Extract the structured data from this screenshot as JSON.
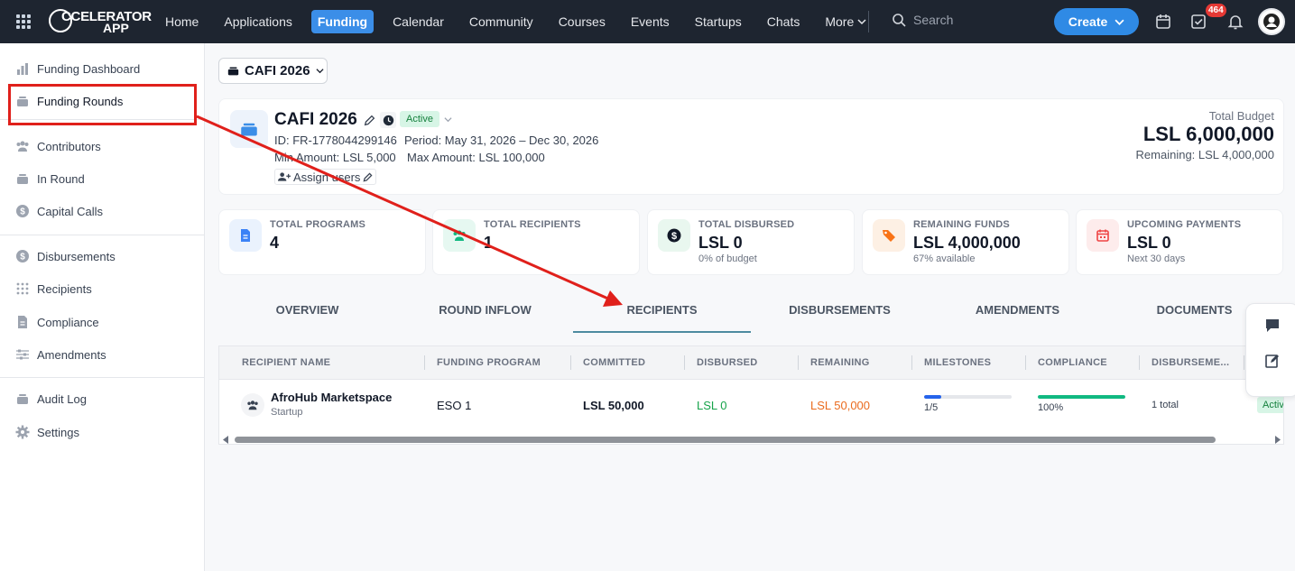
{
  "topbar": {
    "logo_line1": "CCELERATOR",
    "logo_line2": "APP",
    "nav": [
      "Home",
      "Applications",
      "Funding",
      "Calendar",
      "Community",
      "Courses",
      "Events",
      "Startups",
      "Chats"
    ],
    "more_label": "More",
    "search_placeholder": "Search",
    "create_label": "Create",
    "notification_count": "464"
  },
  "sidebar": {
    "items": [
      {
        "label": "Funding Dashboard",
        "icon": "bar-chart-icon"
      },
      {
        "label": "Funding Rounds",
        "icon": "stack-icon"
      },
      {
        "label": "Contributors",
        "icon": "users-icon"
      },
      {
        "label": "In Round",
        "icon": "layers-icon"
      },
      {
        "label": "Capital Calls",
        "icon": "dollar-circle-icon"
      },
      {
        "label": "Disbursements",
        "icon": "dollar-circle-icon"
      },
      {
        "label": "Recipients",
        "icon": "dots-grid-icon"
      },
      {
        "label": "Compliance",
        "icon": "document-icon"
      },
      {
        "label": "Amendments",
        "icon": "sliders-icon"
      },
      {
        "label": "Audit Log",
        "icon": "layers-icon"
      },
      {
        "label": "Settings",
        "icon": "gear-icon"
      }
    ]
  },
  "round_selector": "CAFI 2026",
  "round": {
    "title": "CAFI 2026",
    "status": "Active",
    "id_line": "ID: FR-1778044299146",
    "period_line": "Period: May 31, 2026 – Dec 30, 2026",
    "min_line": "Min Amount: LSL 5,000",
    "max_line": "Max Amount: LSL 100,000",
    "assign_label": "Assign users",
    "budget_label": "Total Budget",
    "budget_value": "LSL 6,000,000",
    "remaining": "Remaining: LSL 4,000,000"
  },
  "stats": [
    {
      "label": "TOTAL PROGRAMS",
      "value": "4",
      "sub": "",
      "color": "#3b82f6",
      "bg": "#eaf2fd"
    },
    {
      "label": "TOTAL RECIPIENTS",
      "value": "1",
      "sub": "",
      "color": "#10b981",
      "bg": "#e6f8f1"
    },
    {
      "label": "TOTAL DISBURSED",
      "value": "LSL 0",
      "sub": "0% of budget",
      "color": "#111827",
      "bg": "#e9f7ef"
    },
    {
      "label": "REMAINING FUNDS",
      "value": "LSL 4,000,000",
      "sub": "67% available",
      "color": "#f97316",
      "bg": "#fdf0e4"
    },
    {
      "label": "UPCOMING PAYMENTS",
      "value": "LSL 0",
      "sub": "Next 30 days",
      "color": "#ef4444",
      "bg": "#fdecec"
    }
  ],
  "tabs": [
    "OVERVIEW",
    "ROUND INFLOW",
    "RECIPIENTS",
    "DISBURSEMENTS",
    "AMENDMENTS",
    "DOCUMENTS"
  ],
  "table": {
    "headers": [
      "RECIPIENT NAME",
      "FUNDING PROGRAM",
      "COMMITTED",
      "DISBURSED",
      "REMAINING",
      "MILESTONES",
      "COMPLIANCE",
      "DISBURSEME..."
    ],
    "row": {
      "name": "AfroHub Marketspace",
      "type": "Startup",
      "program": "ESO 1",
      "committed": "LSL 50,000",
      "disbursed": "LSL 0",
      "remaining": "LSL 50,000",
      "milestones_text": "1/5",
      "milestones_fraction": 0.2,
      "compliance_text": "100%",
      "compliance_fraction": 1.0,
      "disbursements": "1 total",
      "status": "Activ"
    }
  },
  "colors": {
    "accent": "#2f8ae5",
    "topbar": "#1e2530",
    "annotation": "#e0201b",
    "disbursed": "#16a34a",
    "remaining": "#ea6b1e"
  }
}
